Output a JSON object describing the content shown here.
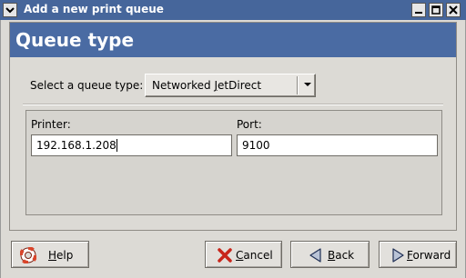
{
  "window": {
    "title": "Add a new print queue"
  },
  "header": {
    "title": "Queue type"
  },
  "queue_type": {
    "label": "Select a queue type:",
    "selected": "Networked JetDirect",
    "selected_prefix": "Networked ",
    "selected_mnemonic": "J",
    "selected_suffix": "etDirect"
  },
  "fields": {
    "printer_label": "Printer:",
    "printer_value": "192.168.1.208",
    "port_label": "Port:",
    "port_value": "9100"
  },
  "buttons": {
    "help": {
      "mnemonic": "H",
      "rest": "elp",
      "icon": "help-lifebuoy-icon"
    },
    "cancel": {
      "mnemonic": "C",
      "rest": "ancel",
      "icon": "red-x-icon"
    },
    "back": {
      "mnemonic": "B",
      "rest": "ack",
      "icon": "left-arrow-icon"
    },
    "forward": {
      "mnemonic": "F",
      "rest": "orward",
      "icon": "right-arrow-icon"
    }
  },
  "colors": {
    "titlebar": "#46669b",
    "header_band": "#4a6ba3",
    "window_bg": "#dcdad5"
  }
}
